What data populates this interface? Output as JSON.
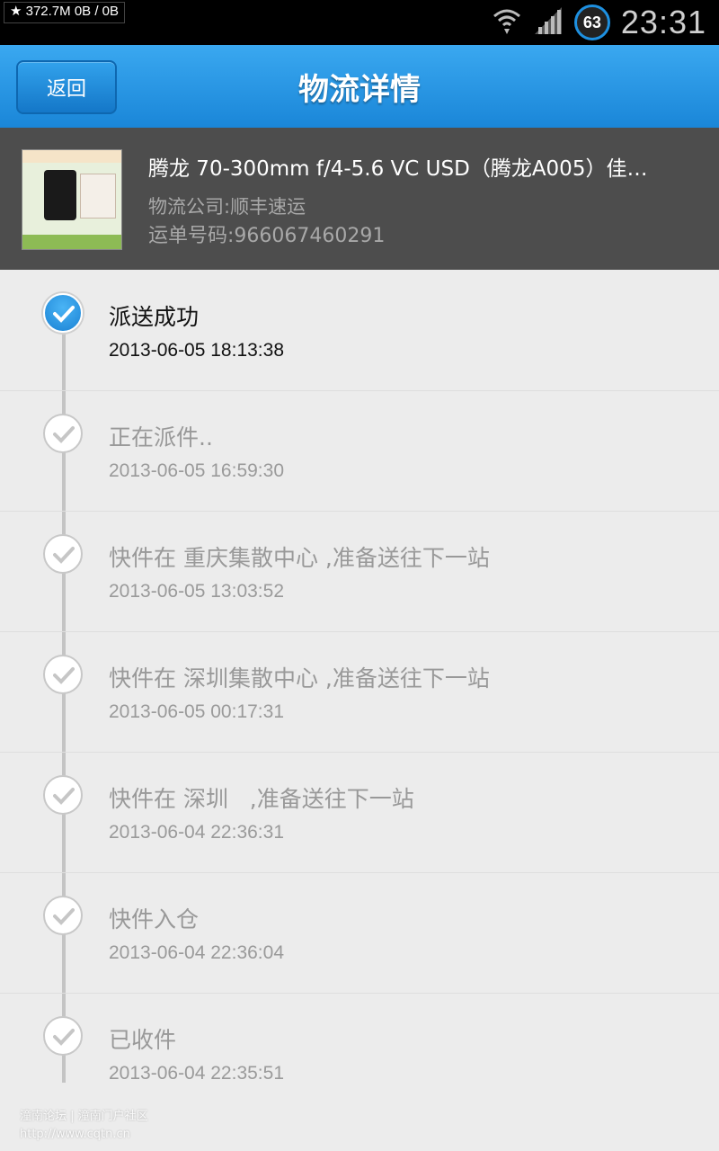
{
  "status_bar": {
    "left_text": "★ 372.7M  0B / 0B",
    "battery": "63",
    "clock": "23:31",
    "icons": [
      "wifi-icon",
      "signal-icon",
      "battery-icon"
    ]
  },
  "header": {
    "back_label": "返回",
    "title": "物流详情"
  },
  "product": {
    "name": "腾龙 70-300mm f/4-5.6 VC USD（腾龙A005）佳…",
    "company": "物流公司:顺丰速运",
    "tracking": "运单号码:966067460291"
  },
  "timeline": [
    {
      "title": "派送成功",
      "time": "2013-06-05 18:13:38",
      "active": true
    },
    {
      "title": "正在派件..",
      "time": "2013-06-05 16:59:30",
      "active": false
    },
    {
      "title": "快件在 重庆集散中心 ,准备送往下一站",
      "time": "2013-06-05 13:03:52",
      "active": false
    },
    {
      "title": "快件在 深圳集散中心 ,准备送往下一站",
      "time": "2013-06-05 00:17:31",
      "active": false
    },
    {
      "title": "快件在 深圳   ,准备送往下一站",
      "time": "2013-06-04 22:36:31",
      "active": false
    },
    {
      "title": "快件入仓",
      "time": "2013-06-04 22:36:04",
      "active": false
    },
    {
      "title": "已收件",
      "time": "2013-06-04 22:35:51",
      "active": false
    }
  ],
  "watermark": {
    "line1": "潼南论坛 | 潼南门户社区",
    "line2": "http://www.cqtn.cn"
  },
  "colors": {
    "header_blue": "#1a86d8",
    "active_dot": "#1a82d4",
    "panel_gray": "#4d4d4d"
  }
}
